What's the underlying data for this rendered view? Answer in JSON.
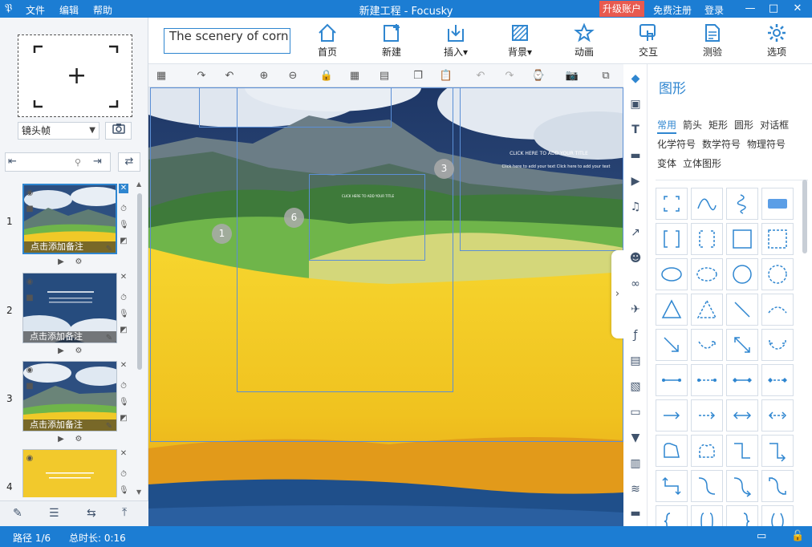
{
  "app": {
    "logo": "𝔓",
    "menus": [
      "文件",
      "编辑",
      "帮助"
    ],
    "window_title": "新建工程 - Focusky",
    "upgrade": "升级账户",
    "register": "免费注册",
    "login": "登录",
    "window_buttons": [
      "—",
      "□",
      "✕"
    ]
  },
  "toolbar": {
    "title_value": "The scenery of corn",
    "tools": [
      {
        "label": "首页",
        "icon": "home-icon"
      },
      {
        "label": "新建",
        "icon": "new-frame-icon"
      },
      {
        "label": "插入",
        "icon": "insert-icon",
        "dropdown": true
      },
      {
        "label": "背景",
        "icon": "background-icon",
        "dropdown": true
      },
      {
        "label": "动画",
        "icon": "animation-icon"
      },
      {
        "label": "交互",
        "icon": "interaction-icon"
      },
      {
        "label": "测验",
        "icon": "quiz-icon"
      },
      {
        "label": "选项",
        "icon": "settings-icon"
      }
    ]
  },
  "left": {
    "frame_type": "镜头帧",
    "slides": [
      {
        "num": "1",
        "caption": "点击添加备注",
        "selected": true,
        "style": "landscape"
      },
      {
        "num": "2",
        "caption": "点击添加备注",
        "selected": false,
        "style": "sky"
      },
      {
        "num": "3",
        "caption": "点击添加备注",
        "selected": false,
        "style": "landscape"
      },
      {
        "num": "4",
        "caption": "",
        "selected": false,
        "style": "yellow"
      }
    ]
  },
  "canvas": {
    "badges": [
      "1",
      "6",
      "3"
    ],
    "frame_text_small": "CLICK HERE TO ADD YOUR TITLE",
    "frame_text_body": "Click here to add your text Click here to add your text"
  },
  "right_panel": {
    "title": "图形",
    "tabs": [
      "常用",
      "箭头",
      "矩形",
      "圆形",
      "对话框",
      "化学符号",
      "数学符号",
      "物理符号",
      "变体",
      "立体图形"
    ],
    "active_tab": "常用"
  },
  "status": {
    "path": "路径 1/6",
    "duration": "总时长: 0:16"
  },
  "colors": {
    "accent": "#1c7dd3",
    "upgrade": "#e85a4f",
    "panel_blue": "#2f86d0"
  }
}
